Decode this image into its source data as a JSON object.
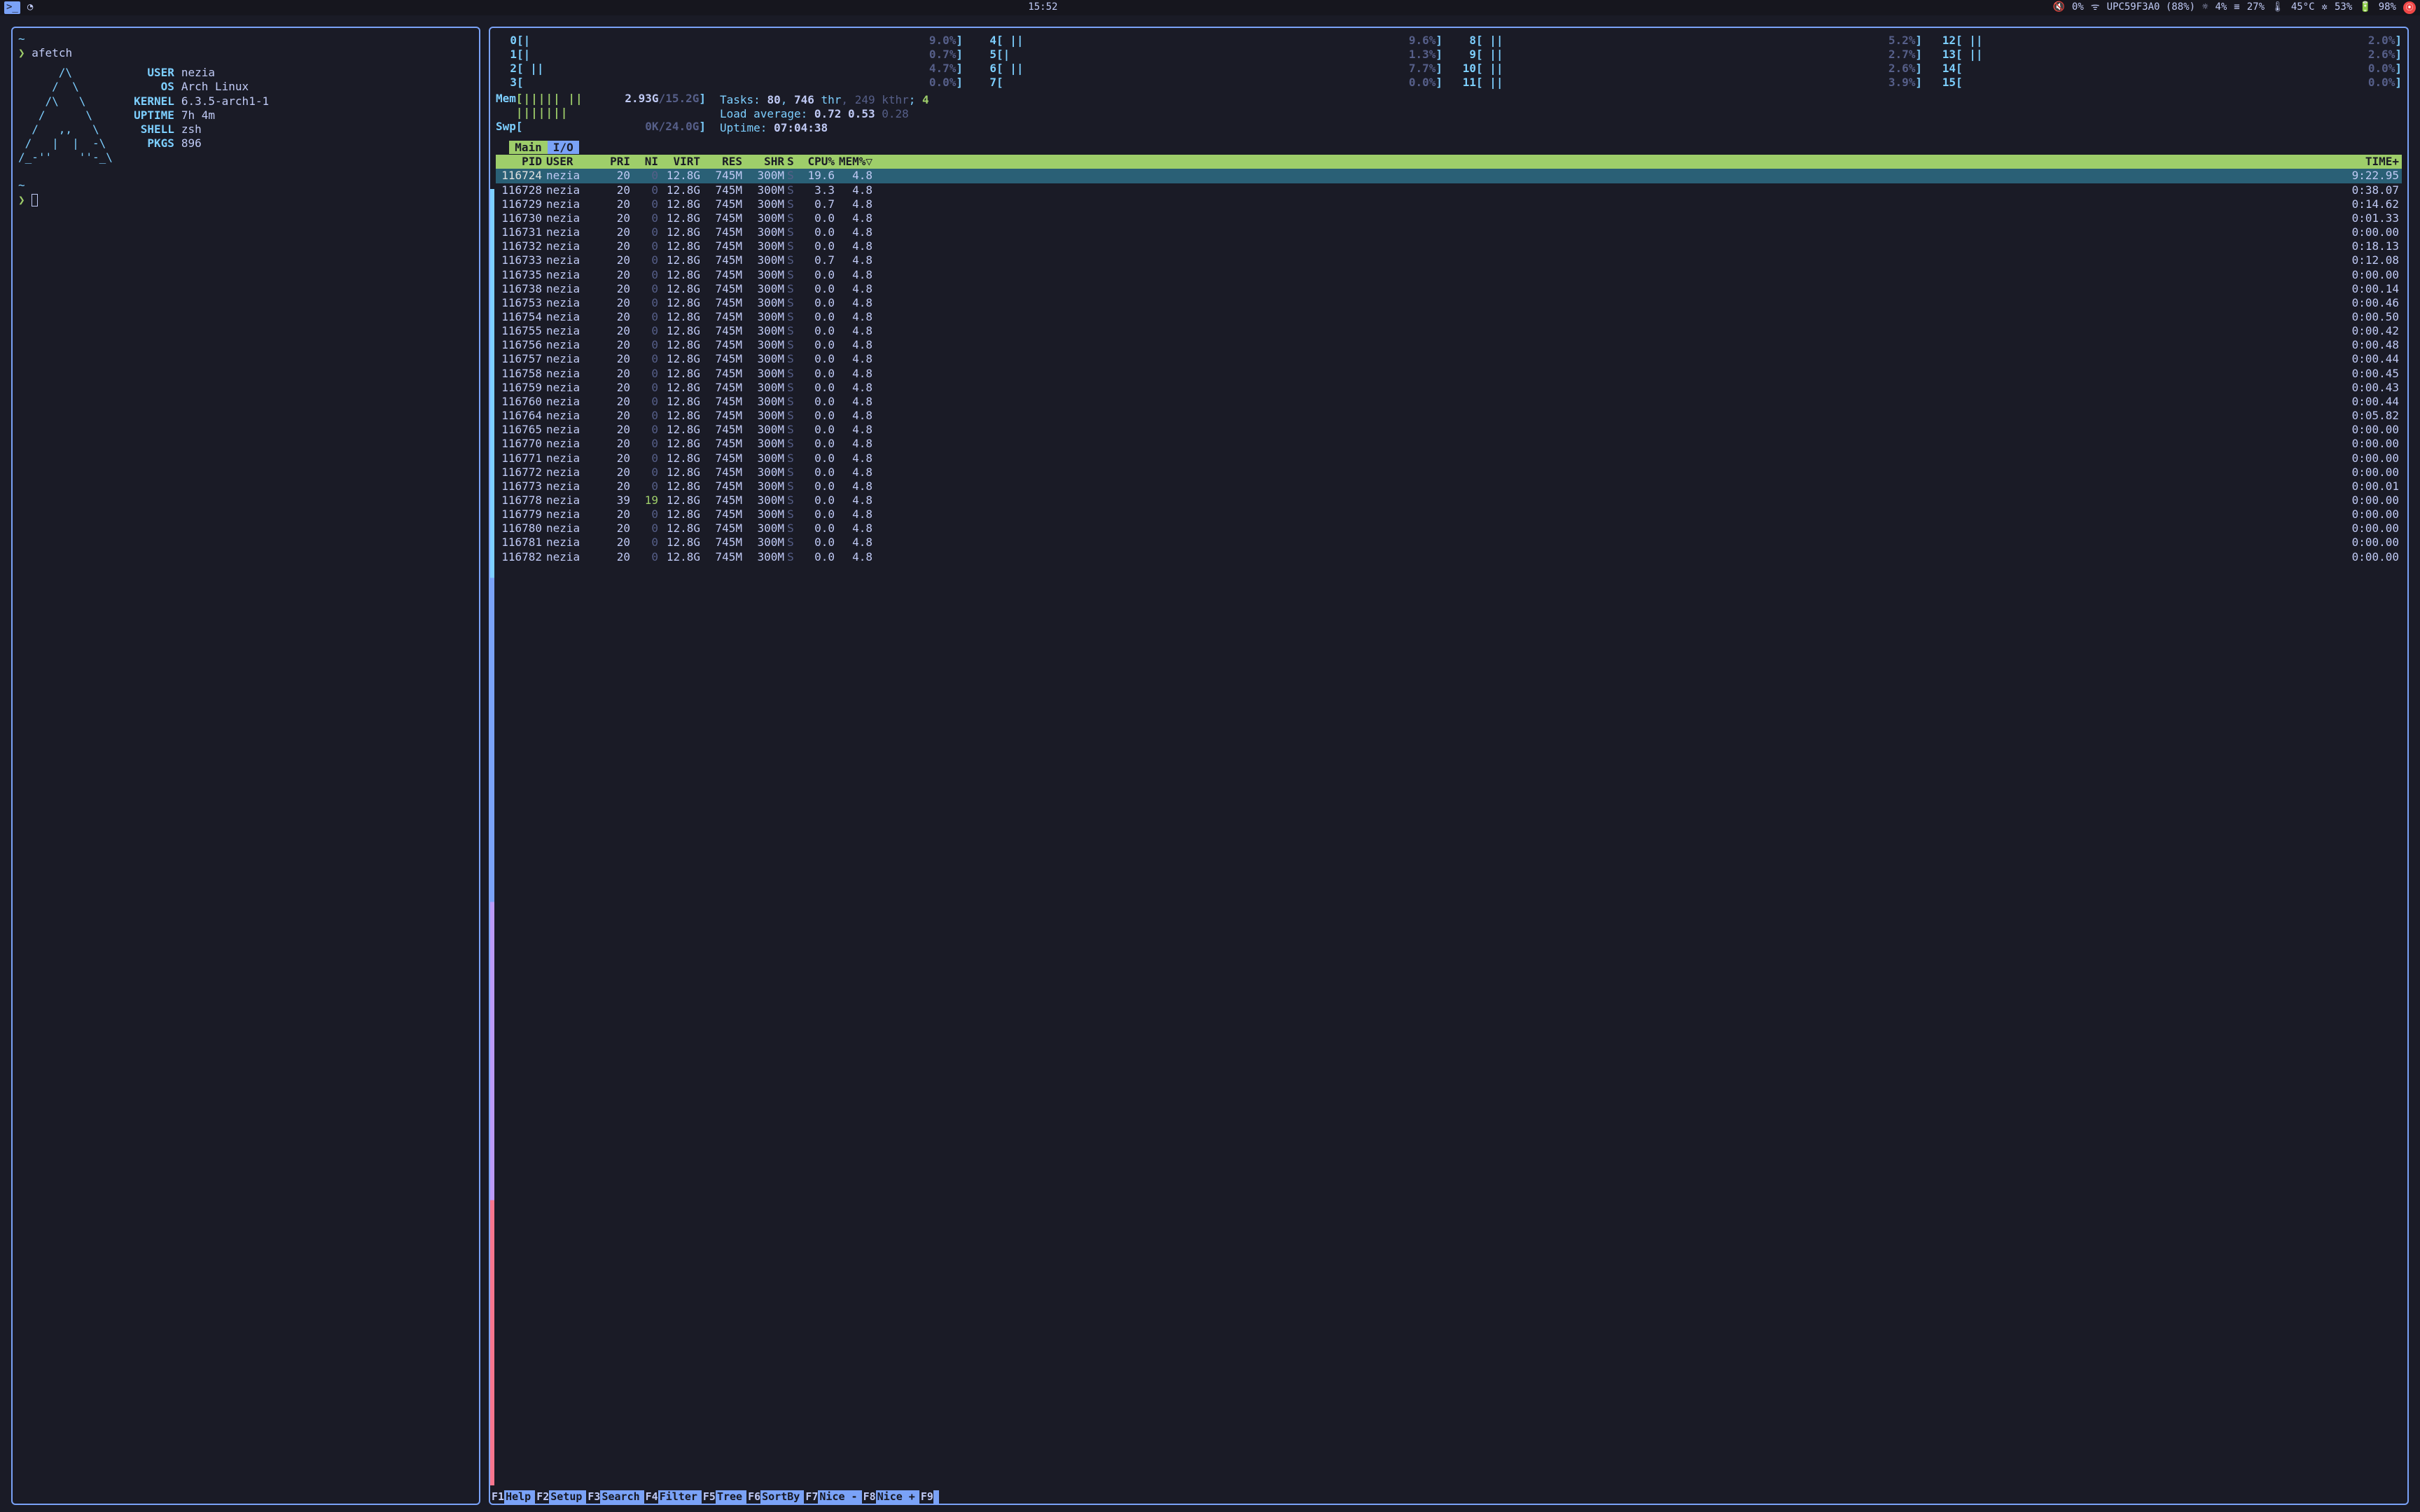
{
  "topbar": {
    "time": "15:52",
    "volume_muted": true,
    "volume_pct": "0%",
    "wifi": "UPC59F3A0 (88%)",
    "brightness": "4%",
    "ram": "27%",
    "temp": "45°C",
    "fan": "53%",
    "battery": "98%"
  },
  "afetch": {
    "prompt": "❯",
    "cmd": "afetch",
    "art": "      /\\\n     /  \\\n    /\\   \\\n   /      \\\n  /   ,,   \\\n /   |  |  -\\\n/_-''    ''-_\\",
    "labels": {
      "user": "USER",
      "os": "OS",
      "kernel": "KERNEL",
      "uptime": "UPTIME",
      "shell": "SHELL",
      "pkgs": "PKGS"
    },
    "user": "nezia",
    "os": "Arch Linux",
    "kernel": "6.3.5-arch1-1",
    "uptime": "7h 4m",
    "shell": "zsh",
    "pkgs": "896"
  },
  "htop": {
    "cpus": [
      {
        "id": 0,
        "bar": "[|",
        "pct": "9.0%",
        "pct_hi": true
      },
      {
        "id": 4,
        "bar": "[ ||",
        "pct": "9.6%",
        "pct_hi": true
      },
      {
        "id": 8,
        "bar": "[ ||",
        "pct": "5.2%",
        "pct_hi": true
      },
      {
        "id": 12,
        "bar": "[ ||",
        "pct": "2.0%"
      },
      {
        "id": 1,
        "bar": "[|",
        "pct": "0.7%"
      },
      {
        "id": 5,
        "bar": "[|",
        "pct": "1.3%"
      },
      {
        "id": 9,
        "bar": "[ ||",
        "pct": "2.7%"
      },
      {
        "id": 13,
        "bar": "[ ||",
        "pct": "2.6%"
      },
      {
        "id": 2,
        "bar": "[ ||",
        "pct": "4.7%"
      },
      {
        "id": 6,
        "bar": "[ ||",
        "pct": "7.7%",
        "pct_hi": true
      },
      {
        "id": 10,
        "bar": "[ ||",
        "pct": "2.6%"
      },
      {
        "id": 14,
        "bar": "[",
        "pct": "0.0%"
      },
      {
        "id": 3,
        "bar": "[",
        "pct": "0.0%"
      },
      {
        "id": 7,
        "bar": "[",
        "pct": "0.0%"
      },
      {
        "id": 11,
        "bar": "[ ||",
        "pct": "3.9%"
      },
      {
        "id": 15,
        "bar": "[",
        "pct": "0.0%"
      }
    ],
    "mem": {
      "label": "Mem",
      "bar": "[||||| || |||||||",
      "used": "2.93G",
      "total": "15.2G"
    },
    "swp": {
      "label": "Swp",
      "bar": "[",
      "used": "0K",
      "total": "24.0G"
    },
    "tasks": {
      "label": "Tasks:",
      "procs": "80",
      "thr": "746",
      "thr_label": "thr",
      "kthr": "249",
      "kthr_label": "kthr",
      "running": "4"
    },
    "load": {
      "label": "Load average:",
      "l1": "0.72",
      "l5": "0.53",
      "l15": "0.28"
    },
    "uptime": {
      "label": "Uptime:",
      "value": "07:04:38"
    },
    "tabs": {
      "active": "Main",
      "inactive": "I/O"
    },
    "columns": {
      "pid": "PID",
      "user": "USER",
      "pri": "PRI",
      "ni": "NI",
      "virt": "VIRT",
      "res": "RES",
      "shr": "SHR",
      "s": "S",
      "cpu": "CPU%",
      "mem": "MEM%▽",
      "time": "TIME+"
    },
    "procs": [
      {
        "pid": 116724,
        "user": "nezia",
        "pri": 20,
        "ni": 0,
        "virt": "12.8G",
        "res": "745M",
        "shr": "300M",
        "s": "S",
        "cpu": "19.6",
        "mem": "4.8",
        "time": "9:22.95",
        "sel": true
      },
      {
        "pid": 116728,
        "user": "nezia",
        "pri": 20,
        "ni": 0,
        "virt": "12.8G",
        "res": "745M",
        "shr": "300M",
        "s": "S",
        "cpu": "3.3",
        "mem": "4.8",
        "time": "0:38.07"
      },
      {
        "pid": 116729,
        "user": "nezia",
        "pri": 20,
        "ni": 0,
        "virt": "12.8G",
        "res": "745M",
        "shr": "300M",
        "s": "S",
        "cpu": "0.7",
        "mem": "4.8",
        "time": "0:14.62"
      },
      {
        "pid": 116730,
        "user": "nezia",
        "pri": 20,
        "ni": 0,
        "virt": "12.8G",
        "res": "745M",
        "shr": "300M",
        "s": "S",
        "cpu": "0.0",
        "mem": "4.8",
        "time": "0:01.33"
      },
      {
        "pid": 116731,
        "user": "nezia",
        "pri": 20,
        "ni": 0,
        "virt": "12.8G",
        "res": "745M",
        "shr": "300M",
        "s": "S",
        "cpu": "0.0",
        "mem": "4.8",
        "time": "0:00.00"
      },
      {
        "pid": 116732,
        "user": "nezia",
        "pri": 20,
        "ni": 0,
        "virt": "12.8G",
        "res": "745M",
        "shr": "300M",
        "s": "S",
        "cpu": "0.0",
        "mem": "4.8",
        "time": "0:18.13"
      },
      {
        "pid": 116733,
        "user": "nezia",
        "pri": 20,
        "ni": 0,
        "virt": "12.8G",
        "res": "745M",
        "shr": "300M",
        "s": "S",
        "cpu": "0.7",
        "mem": "4.8",
        "time": "0:12.08"
      },
      {
        "pid": 116735,
        "user": "nezia",
        "pri": 20,
        "ni": 0,
        "virt": "12.8G",
        "res": "745M",
        "shr": "300M",
        "s": "S",
        "cpu": "0.0",
        "mem": "4.8",
        "time": "0:00.00"
      },
      {
        "pid": 116738,
        "user": "nezia",
        "pri": 20,
        "ni": 0,
        "virt": "12.8G",
        "res": "745M",
        "shr": "300M",
        "s": "S",
        "cpu": "0.0",
        "mem": "4.8",
        "time": "0:00.14"
      },
      {
        "pid": 116753,
        "user": "nezia",
        "pri": 20,
        "ni": 0,
        "virt": "12.8G",
        "res": "745M",
        "shr": "300M",
        "s": "S",
        "cpu": "0.0",
        "mem": "4.8",
        "time": "0:00.46"
      },
      {
        "pid": 116754,
        "user": "nezia",
        "pri": 20,
        "ni": 0,
        "virt": "12.8G",
        "res": "745M",
        "shr": "300M",
        "s": "S",
        "cpu": "0.0",
        "mem": "4.8",
        "time": "0:00.50"
      },
      {
        "pid": 116755,
        "user": "nezia",
        "pri": 20,
        "ni": 0,
        "virt": "12.8G",
        "res": "745M",
        "shr": "300M",
        "s": "S",
        "cpu": "0.0",
        "mem": "4.8",
        "time": "0:00.42"
      },
      {
        "pid": 116756,
        "user": "nezia",
        "pri": 20,
        "ni": 0,
        "virt": "12.8G",
        "res": "745M",
        "shr": "300M",
        "s": "S",
        "cpu": "0.0",
        "mem": "4.8",
        "time": "0:00.48"
      },
      {
        "pid": 116757,
        "user": "nezia",
        "pri": 20,
        "ni": 0,
        "virt": "12.8G",
        "res": "745M",
        "shr": "300M",
        "s": "S",
        "cpu": "0.0",
        "mem": "4.8",
        "time": "0:00.44"
      },
      {
        "pid": 116758,
        "user": "nezia",
        "pri": 20,
        "ni": 0,
        "virt": "12.8G",
        "res": "745M",
        "shr": "300M",
        "s": "S",
        "cpu": "0.0",
        "mem": "4.8",
        "time": "0:00.45"
      },
      {
        "pid": 116759,
        "user": "nezia",
        "pri": 20,
        "ni": 0,
        "virt": "12.8G",
        "res": "745M",
        "shr": "300M",
        "s": "S",
        "cpu": "0.0",
        "mem": "4.8",
        "time": "0:00.43"
      },
      {
        "pid": 116760,
        "user": "nezia",
        "pri": 20,
        "ni": 0,
        "virt": "12.8G",
        "res": "745M",
        "shr": "300M",
        "s": "S",
        "cpu": "0.0",
        "mem": "4.8",
        "time": "0:00.44"
      },
      {
        "pid": 116764,
        "user": "nezia",
        "pri": 20,
        "ni": 0,
        "virt": "12.8G",
        "res": "745M",
        "shr": "300M",
        "s": "S",
        "cpu": "0.0",
        "mem": "4.8",
        "time": "0:05.82"
      },
      {
        "pid": 116765,
        "user": "nezia",
        "pri": 20,
        "ni": 0,
        "virt": "12.8G",
        "res": "745M",
        "shr": "300M",
        "s": "S",
        "cpu": "0.0",
        "mem": "4.8",
        "time": "0:00.00"
      },
      {
        "pid": 116770,
        "user": "nezia",
        "pri": 20,
        "ni": 0,
        "virt": "12.8G",
        "res": "745M",
        "shr": "300M",
        "s": "S",
        "cpu": "0.0",
        "mem": "4.8",
        "time": "0:00.00"
      },
      {
        "pid": 116771,
        "user": "nezia",
        "pri": 20,
        "ni": 0,
        "virt": "12.8G",
        "res": "745M",
        "shr": "300M",
        "s": "S",
        "cpu": "0.0",
        "mem": "4.8",
        "time": "0:00.00"
      },
      {
        "pid": 116772,
        "user": "nezia",
        "pri": 20,
        "ni": 0,
        "virt": "12.8G",
        "res": "745M",
        "shr": "300M",
        "s": "S",
        "cpu": "0.0",
        "mem": "4.8",
        "time": "0:00.00"
      },
      {
        "pid": 116773,
        "user": "nezia",
        "pri": 20,
        "ni": 0,
        "virt": "12.8G",
        "res": "745M",
        "shr": "300M",
        "s": "S",
        "cpu": "0.0",
        "mem": "4.8",
        "time": "0:00.01"
      },
      {
        "pid": 116778,
        "user": "nezia",
        "pri": 39,
        "ni": 19,
        "virt": "12.8G",
        "res": "745M",
        "shr": "300M",
        "s": "S",
        "cpu": "0.0",
        "mem": "4.8",
        "time": "0:00.00"
      },
      {
        "pid": 116779,
        "user": "nezia",
        "pri": 20,
        "ni": 0,
        "virt": "12.8G",
        "res": "745M",
        "shr": "300M",
        "s": "S",
        "cpu": "0.0",
        "mem": "4.8",
        "time": "0:00.00"
      },
      {
        "pid": 116780,
        "user": "nezia",
        "pri": 20,
        "ni": 0,
        "virt": "12.8G",
        "res": "745M",
        "shr": "300M",
        "s": "S",
        "cpu": "0.0",
        "mem": "4.8",
        "time": "0:00.00"
      },
      {
        "pid": 116781,
        "user": "nezia",
        "pri": 20,
        "ni": 0,
        "virt": "12.8G",
        "res": "745M",
        "shr": "300M",
        "s": "S",
        "cpu": "0.0",
        "mem": "4.8",
        "time": "0:00.00"
      },
      {
        "pid": 116782,
        "user": "nezia",
        "pri": 20,
        "ni": 0,
        "virt": "12.8G",
        "res": "745M",
        "shr": "300M",
        "s": "S",
        "cpu": "0.0",
        "mem": "4.8",
        "time": "0:00.00"
      }
    ],
    "fkeys": [
      {
        "k": "F1",
        "l": "Help"
      },
      {
        "k": "F2",
        "l": "Setup"
      },
      {
        "k": "F3",
        "l": "Search"
      },
      {
        "k": "F4",
        "l": "Filter"
      },
      {
        "k": "F5",
        "l": "Tree"
      },
      {
        "k": "F6",
        "l": "SortBy"
      },
      {
        "k": "F7",
        "l": "Nice -"
      },
      {
        "k": "F8",
        "l": "Nice +"
      },
      {
        "k": "F9",
        "l": ""
      }
    ]
  }
}
